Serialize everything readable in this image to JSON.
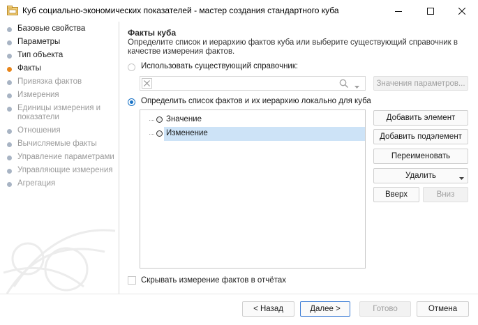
{
  "window": {
    "title": "Куб социально-экономических показателей - мастер создания стандартного куба",
    "icon": "cube-window-icon"
  },
  "colors": {
    "accent": "#1a73c6",
    "active_dot": "#e8851a",
    "done_dot": "#a8b4c4",
    "inactive_text": "#9a9a9a",
    "selection": "#cde3f7"
  },
  "sidebar": {
    "items": [
      {
        "label": "Базовые свойства",
        "state": "done"
      },
      {
        "label": "Параметры",
        "state": "done"
      },
      {
        "label": "Тип объекта",
        "state": "done"
      },
      {
        "label": "Факты",
        "state": "active"
      },
      {
        "label": "Привязка фактов",
        "state": "inactive"
      },
      {
        "label": "Измерения",
        "state": "inactive"
      },
      {
        "label": "Единицы измерения и показатели",
        "state": "inactive"
      },
      {
        "label": "Отношения",
        "state": "inactive"
      },
      {
        "label": "Вычисляемые факты",
        "state": "inactive"
      },
      {
        "label": "Управление параметрами",
        "state": "inactive"
      },
      {
        "label": "Управляющие измерения",
        "state": "inactive"
      },
      {
        "label": "Агрегация",
        "state": "inactive"
      }
    ]
  },
  "main": {
    "title": "Факты куба",
    "description": "Определите список и иерархию фактов куба или выберите существующий справочник в качестве измерения фактов.",
    "option_existing": {
      "label": "Использовать существующий справочник:",
      "checked": false
    },
    "combo": {
      "value": ""
    },
    "param_values_button": "Значения параметров...",
    "option_local": {
      "label": "Определить список фактов и их иерархию локально для куба",
      "checked": true
    },
    "tree": [
      {
        "label": "Значение",
        "selected": false
      },
      {
        "label": "Изменение",
        "selected": true
      }
    ],
    "buttons": {
      "add_element": "Добавить элемент",
      "add_child": "Добавить подэлемент",
      "rename": "Переименовать",
      "delete": "Удалить",
      "up": "Вверх",
      "down": "Вниз"
    },
    "hide_checkbox": {
      "label": "Скрывать измерение фактов в отчётах",
      "checked": false
    }
  },
  "footer": {
    "back": "< Назад",
    "next": "Далее >",
    "done": "Готово",
    "cancel": "Отмена"
  }
}
